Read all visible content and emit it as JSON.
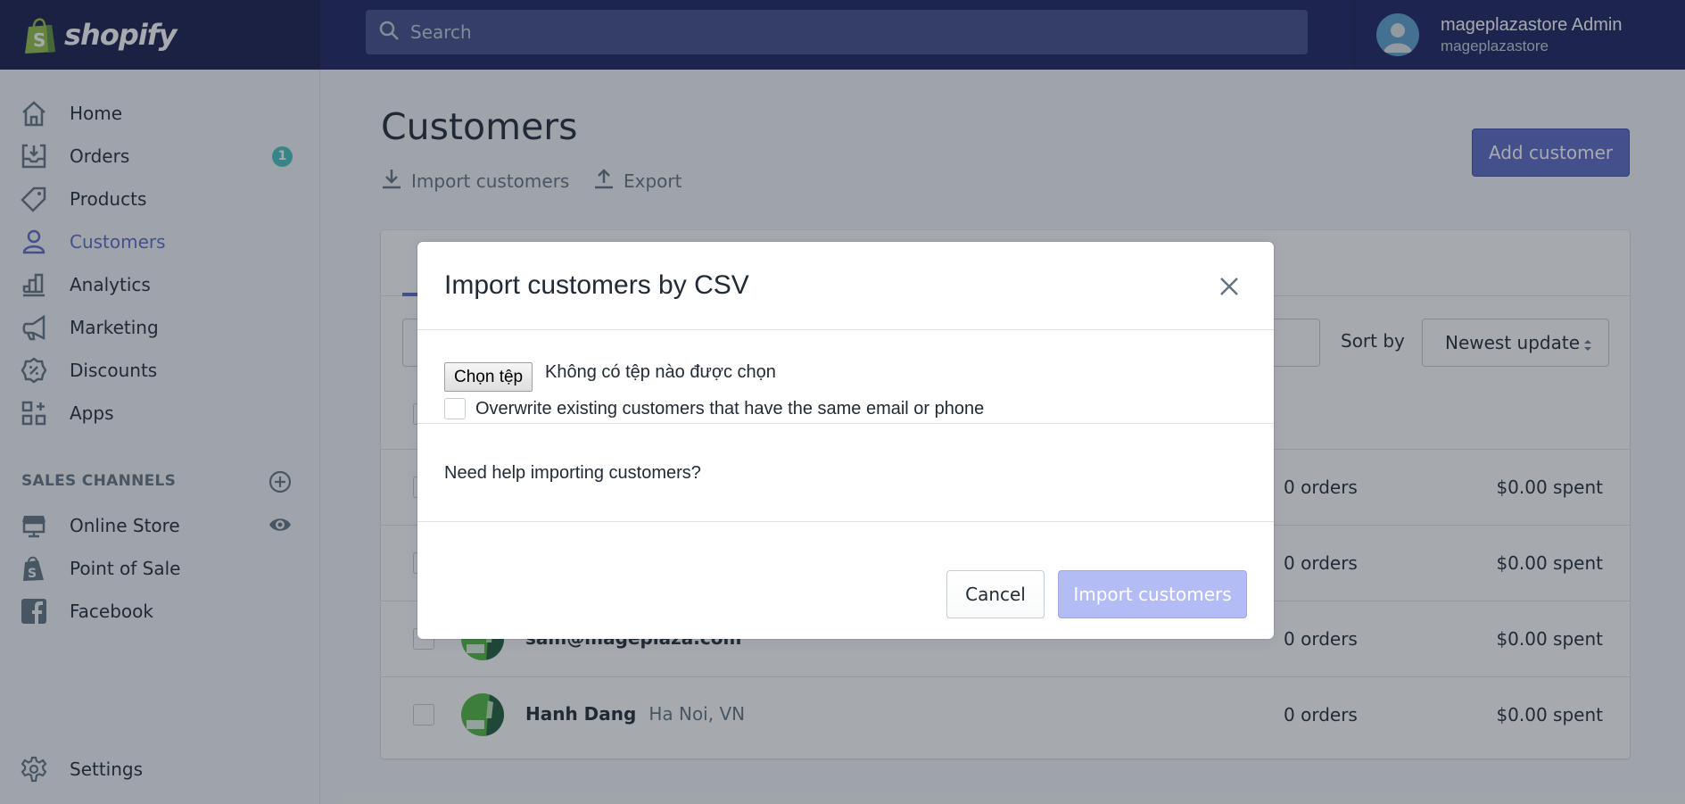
{
  "topbar": {
    "brand": "shopify",
    "search_placeholder": "Search",
    "account_name": "mageplazastore Admin",
    "account_store": "mageplazastore"
  },
  "sidebar": {
    "items": [
      {
        "label": "Home",
        "icon": "home-icon"
      },
      {
        "label": "Orders",
        "icon": "orders-icon",
        "badge": "1"
      },
      {
        "label": "Products",
        "icon": "tag-icon"
      },
      {
        "label": "Customers",
        "icon": "customer-icon",
        "active": true
      },
      {
        "label": "Analytics",
        "icon": "analytics-icon"
      },
      {
        "label": "Marketing",
        "icon": "megaphone-icon"
      },
      {
        "label": "Discounts",
        "icon": "discount-icon"
      },
      {
        "label": "Apps",
        "icon": "apps-icon"
      }
    ],
    "sales_channels_header": "SALES CHANNELS",
    "channels": [
      {
        "label": "Online Store",
        "icon": "store-icon"
      },
      {
        "label": "Point of Sale",
        "icon": "pos-bag-icon"
      },
      {
        "label": "Facebook",
        "icon": "facebook-icon"
      }
    ],
    "settings_label": "Settings"
  },
  "main": {
    "title": "Customers",
    "import_label": "Import customers",
    "export_label": "Export",
    "add_customer_label": "Add customer",
    "sort_label": "Sort by",
    "sort_value": "Newest update",
    "customers": [
      {
        "name": "",
        "location": "",
        "orders": "0 orders",
        "spent": "$0.00 spent"
      },
      {
        "name": "",
        "location": "",
        "orders": "0 orders",
        "spent": "$0.00 spent"
      },
      {
        "name": "sam@mageplaza.com",
        "location": "",
        "orders": "0 orders",
        "spent": "$0.00 spent"
      },
      {
        "name": "Hanh Dang",
        "location": "Ha Noi, VN",
        "orders": "0 orders",
        "spent": "$0.00 spent"
      }
    ]
  },
  "modal": {
    "title": "Import customers by CSV",
    "file_button": "Chọn tệp",
    "file_status": "Không có tệp nào được chọn",
    "overwrite_label": "Overwrite existing customers that have the same email or phone",
    "overwrite_checked": false,
    "help_text": "Need help importing customers?",
    "cancel_label": "Cancel",
    "import_label": "Import customers"
  },
  "colors": {
    "topbar": "#1c2260",
    "accent": "#5c6ac4",
    "badge": "#47c1bf",
    "import_disabled": "#b3bcf5"
  }
}
